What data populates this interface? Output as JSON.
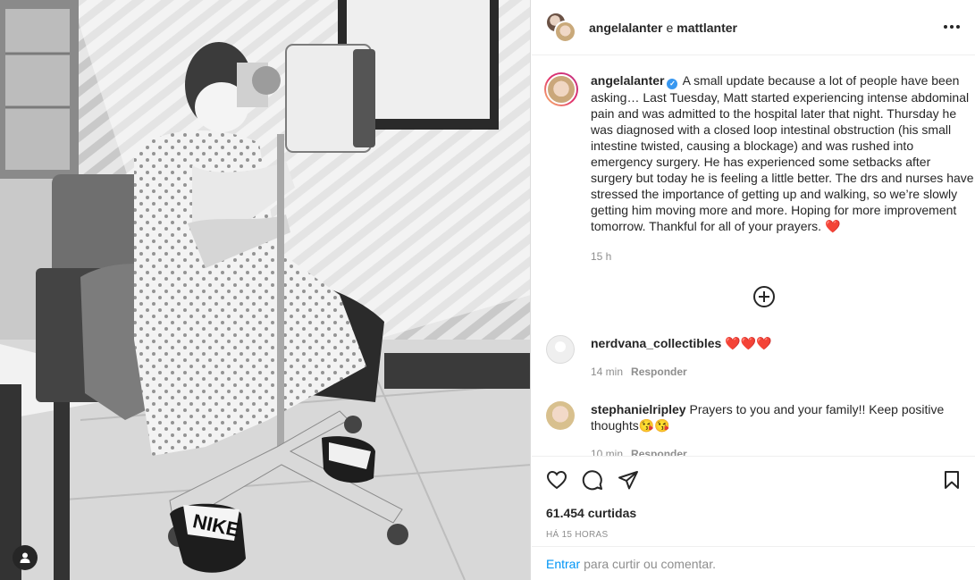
{
  "post": {
    "photo": {
      "alt_icon": "person-tag-icon",
      "slipper_text": "NIKE"
    },
    "header": {
      "user1": "angelalanter",
      "connector": "e",
      "user2": "mattlanter",
      "more_icon": "more-options-icon"
    },
    "caption": {
      "username": "angelalanter",
      "verified_icon": "verified-badge-icon",
      "text": "A small update because a lot of people have been asking… Last Tuesday, Matt started experiencing intense abdominal pain and was admitted to the hospital later that night. Thursday he was diagnosed with a closed loop intestinal obstruction (his small intestine twisted, causing a blockage) and was rushed into emergency surgery. He has experienced some setbacks after surgery but today he is feeling a little better. The drs and nurses have stressed the importance of getting up and walking, so we’re slowly getting him moving more and more. Hoping for more improvement tomorrow. Thankful for all of your prayers. ❤️",
      "time": "15 h"
    },
    "load_more_icon": "plus-circle-icon",
    "comments": [
      {
        "username": "nerdvana_collectibles",
        "text": "❤️❤️❤️",
        "time": "14 min",
        "reply_label": "Responder"
      },
      {
        "username": "stephanielripley",
        "text": "Prayers to you and your family!! Keep positive thoughts😘😘",
        "time": "10 min",
        "reply_label": "Responder"
      }
    ],
    "actions": {
      "like_icon": "heart-icon",
      "comment_icon": "comment-icon",
      "share_icon": "share-icon",
      "save_icon": "bookmark-icon"
    },
    "likes": "61.454 curtidas",
    "posted_ago": "HÁ 15 HORAS",
    "login_prompt": {
      "link": "Entrar",
      "text": "para curtir ou comentar."
    }
  }
}
